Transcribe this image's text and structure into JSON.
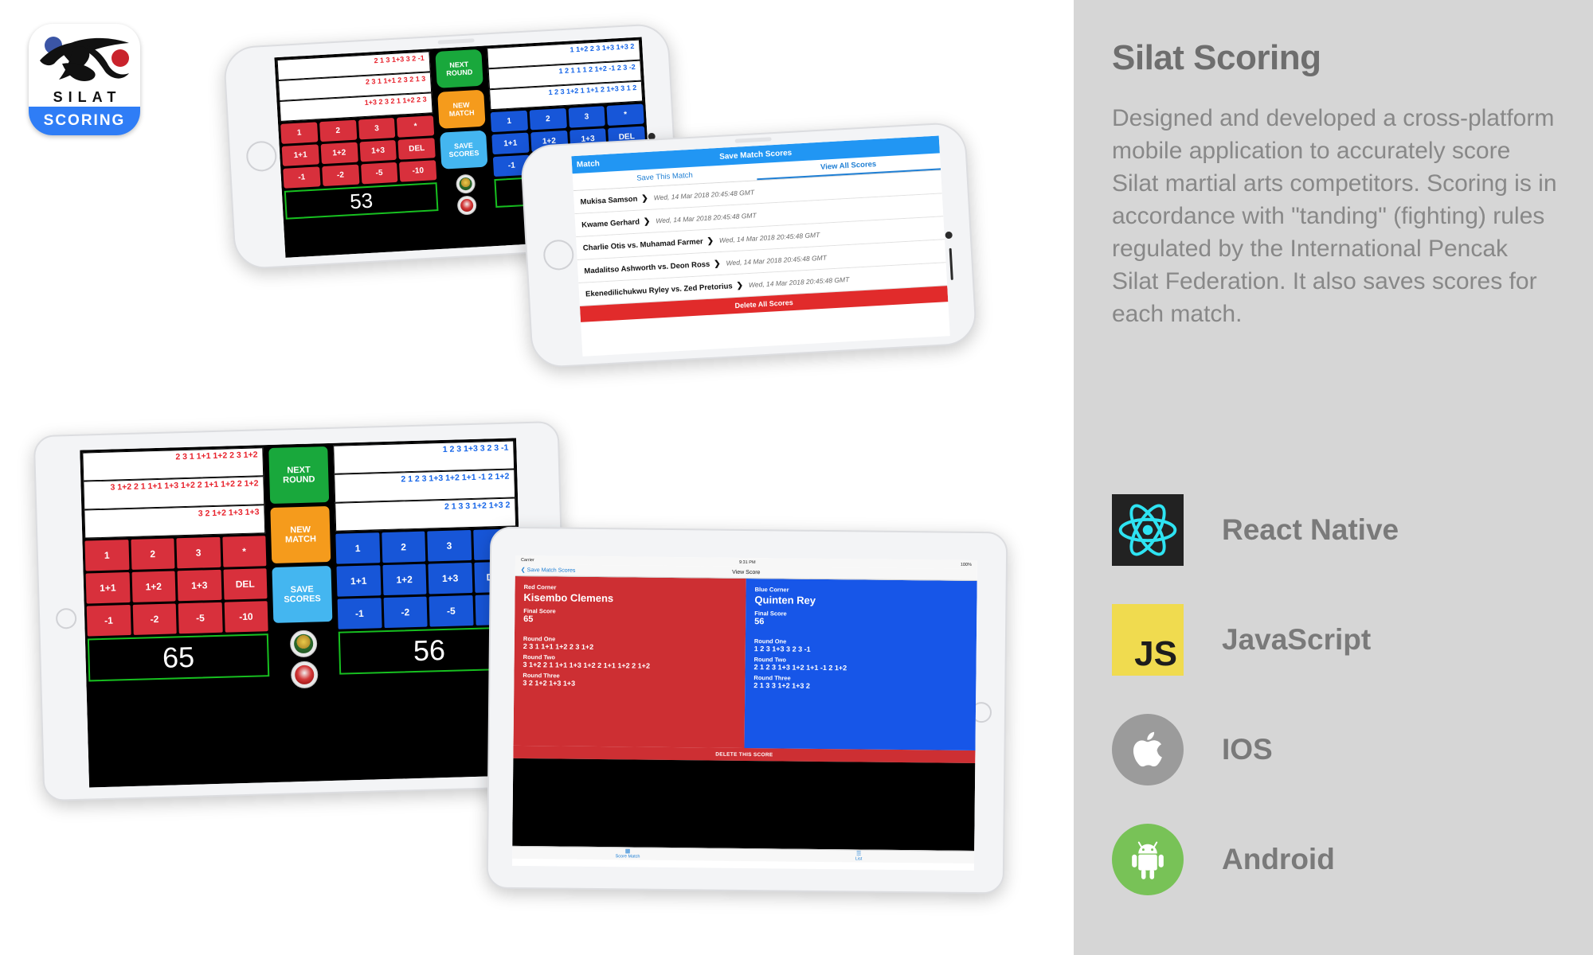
{
  "panel": {
    "title": "Silat Scoring",
    "description": "Designed and developed a cross-platform mobile application to accurately score Silat martial arts competitors. Scoring is in accordance with \"tanding\" (fighting) rules regulated by the International Pencak Silat Federation. It also saves scores for each match.",
    "bg_color": "#d6d6d6",
    "title_color": "#6e6e6e",
    "text_color": "#888888"
  },
  "tech": [
    {
      "icon": "react-native-icon",
      "label": "React Native",
      "color": "#222222"
    },
    {
      "icon": "javascript-icon",
      "label": "JavaScript",
      "color": "#f0db4f",
      "glyph": "JS"
    },
    {
      "icon": "apple-icon",
      "label": "IOS",
      "color": "#9b9b9b"
    },
    {
      "icon": "android-icon",
      "label": "Android",
      "color": "#78c257"
    }
  ],
  "logo": {
    "wordmark": "SILAT",
    "subtitle": "SCORING",
    "bar_color": "#2f7df6",
    "dot_blue": "#3b55a5",
    "dot_red": "#c9232c"
  },
  "controls": {
    "next_round_line1": "NEXT",
    "next_round_line2": "ROUND",
    "new_match_line1": "NEW",
    "new_match_line2": "MATCH",
    "save_scores_line1": "SAVE",
    "save_scores_line2": "SCORES",
    "next_round_color": "#19a83c",
    "new_match_color": "#f59b1c",
    "save_scores_color": "#44b6f0"
  },
  "keypad": {
    "row1": [
      "1",
      "2",
      "3",
      "*"
    ],
    "row2": [
      "1+1",
      "1+2",
      "1+3",
      "DEL"
    ],
    "row3": [
      "-1",
      "-2",
      "-5",
      "-10"
    ],
    "red_color": "#d8303c",
    "blue_color": "#1756d8"
  },
  "phone_scoring": {
    "red": {
      "rounds": [
        "2 1 3 1+3 3 2 -1",
        "2 3 1 1+1 2 3 2 1 3",
        "1+3 2 3 2 1 1+2 2 3"
      ],
      "total": "53",
      "color": "#e8212b"
    },
    "blue": {
      "rounds": [
        "1 1+2 2 3 1+3 1+3 2",
        "1 2 1 1 1 2 1+2 -1 2 3 -2",
        "1 2 3 1+2 1 1+1 2 1+3 3 1 2"
      ],
      "total": "56",
      "color": "#1565e8"
    }
  },
  "tablet_scoring": {
    "red": {
      "rounds": [
        "2 3 1 1+1 1+2 2 3 1+2",
        "3 1+2 2 1 1+1 1+3 1+2 2 1+1 1+2 2 1+2",
        "3 2 1+2 1+3 1+3"
      ],
      "total": "65"
    },
    "blue": {
      "rounds": [
        "1 2 3 1+3 3 2 3 -1",
        "2 1 2 3 1+3 1+2 1+1 -1 2 1+2",
        "2 1 3 3 1+2 1+3 2"
      ],
      "total": "56"
    }
  },
  "match_list": {
    "nav_back": "Match",
    "nav_title": "Save Match Scores",
    "tabs": [
      {
        "label": "Save This Match",
        "active": false
      },
      {
        "label": "View All Scores",
        "active": true
      }
    ],
    "rows": [
      {
        "names": "Mukisa Samson",
        "date": "Wed, 14 Mar 2018 20:45:48 GMT"
      },
      {
        "names": "Kwame Gerhard",
        "date": "Wed, 14 Mar 2018 20:45:48 GMT"
      },
      {
        "names": "Charlie Otis  vs. Muhamad Farmer",
        "date": "Wed, 14 Mar 2018 20:45:48 GMT"
      },
      {
        "names": "Madalitso Ashworth vs. Deon Ross",
        "date": "Wed, 14 Mar 2018 20:45:48 GMT"
      },
      {
        "names": "Ekenedilichukwu Ryley vs. Zed Pretorius",
        "date": "Wed, 14 Mar 2018 20:45:48 GMT"
      }
    ],
    "delete_all": "Delete All Scores"
  },
  "view_score": {
    "carrier": "Carrier",
    "time": "9:31 PM",
    "battery": "100%",
    "back_label": "Save Match Scores",
    "title": "View Score",
    "red": {
      "corner_label": "Red Corner",
      "name": "Kisembo Clemens",
      "final_score_label": "Final Score",
      "final_score": "65",
      "rounds": [
        {
          "label": "Round One",
          "values": "2 3 1 1+1 1+2 2 3 1+2"
        },
        {
          "label": "Round Two",
          "values": "3 1+2 2 1 1+1 1+3 1+2 2 1+1 1+2 2 1+2"
        },
        {
          "label": "Round Three",
          "values": "3 2 1+2 1+3 1+3"
        }
      ],
      "color": "#cd2f33"
    },
    "blue": {
      "corner_label": "Blue Corner",
      "name": "Quinten Rey",
      "final_score_label": "Final Score",
      "final_score": "56",
      "rounds": [
        {
          "label": "Round One",
          "values": "1 2 3 1+3 3 2 3 -1"
        },
        {
          "label": "Round Two",
          "values": "2 1 2 3 1+3 1+2 1+1 -1 2 1+2"
        },
        {
          "label": "Round Three",
          "values": "2 1 3 3 1+2 1+3 2"
        }
      ],
      "color": "#1756e8"
    },
    "delete_button": "DELETE THIS SCORE",
    "tabs": [
      {
        "icon": "grid-icon",
        "label": "Score Match"
      },
      {
        "icon": "list-icon",
        "label": "List"
      }
    ]
  }
}
